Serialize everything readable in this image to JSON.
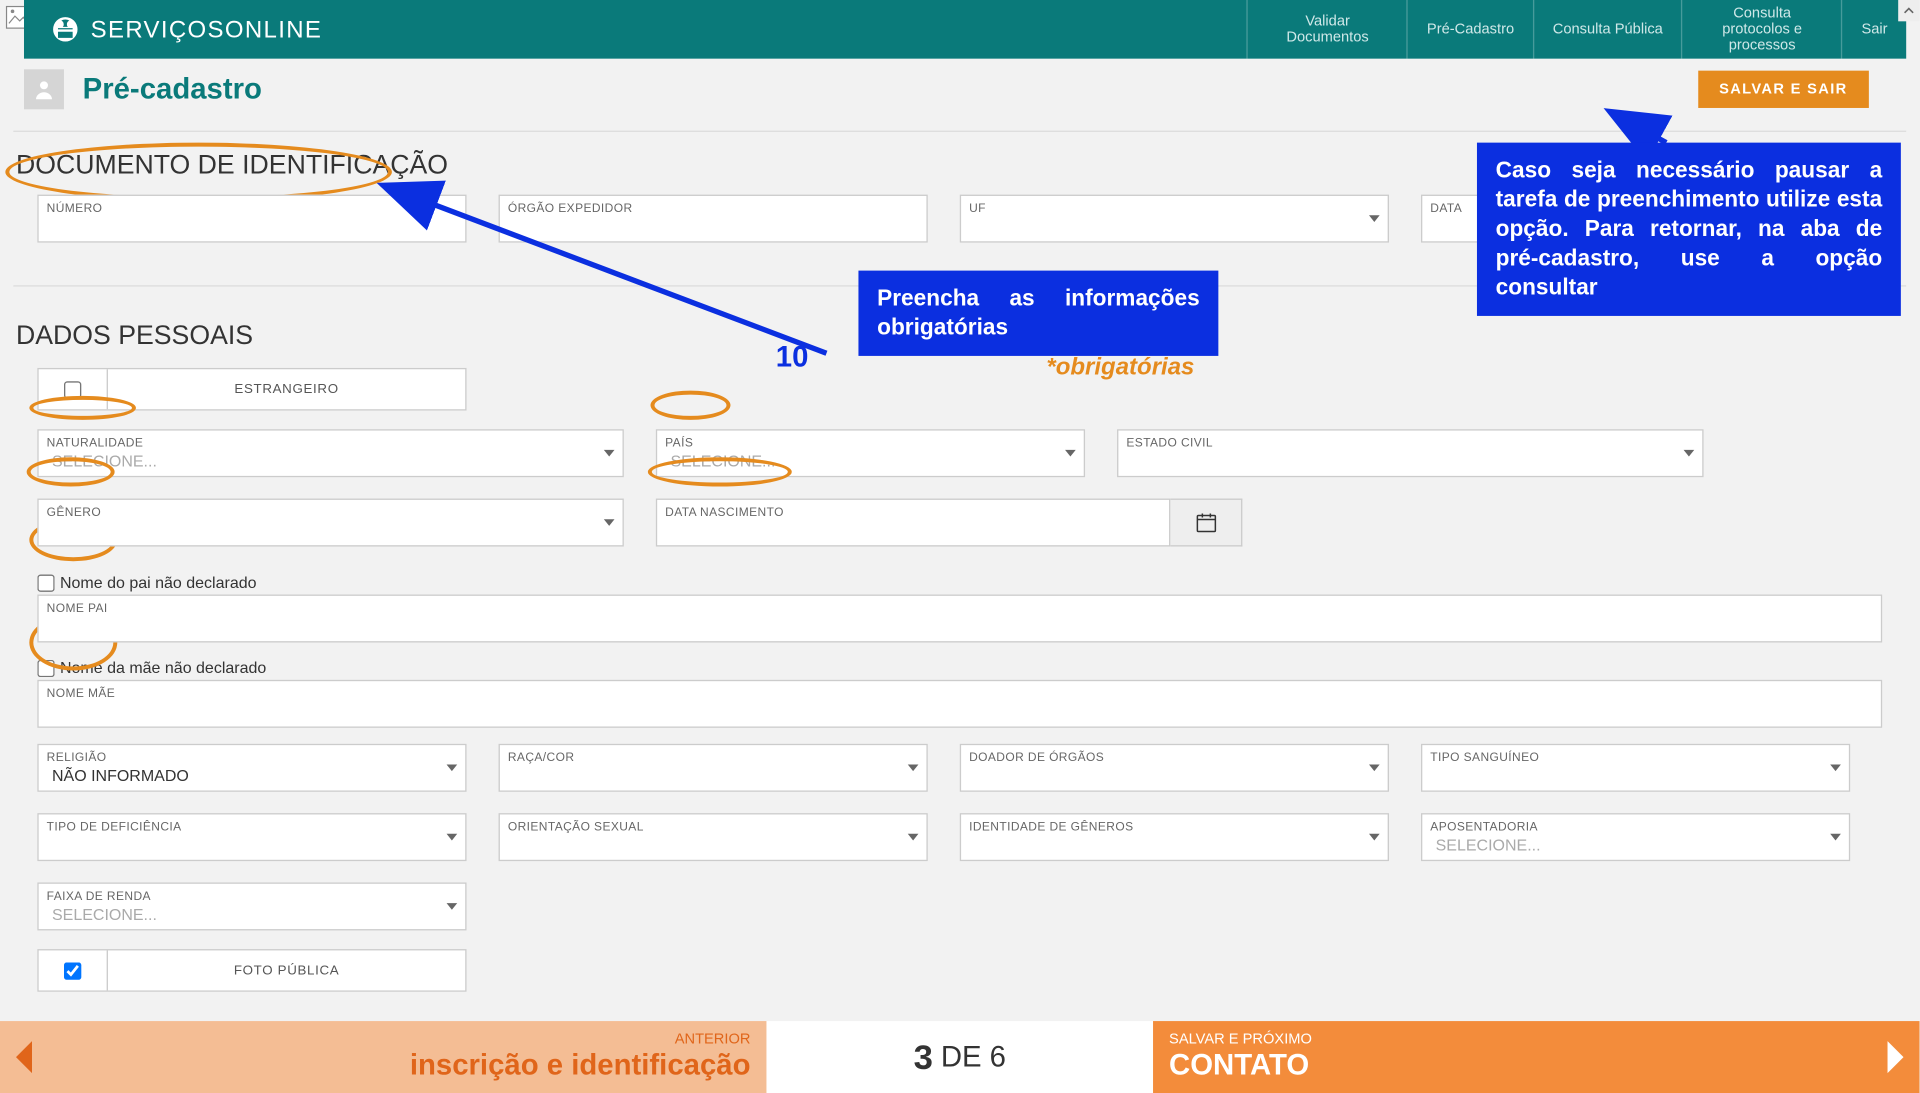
{
  "header": {
    "brand": "SERVIÇOSONLINE",
    "nav": {
      "validar": "Validar Documentos",
      "precadastro": "Pré-Cadastro",
      "consulta": "Consulta Pública",
      "protocolos": "Consulta protocolos e processos",
      "sair": "Sair"
    }
  },
  "page": {
    "title": "Pré-cadastro",
    "save_exit": "SALVAR E SAIR"
  },
  "sections": {
    "documento": {
      "title": "DOCUMENTO DE IDENTIFICAÇÃO",
      "numero": "NÚMERO",
      "orgao": "ÓRGÃO EXPEDIDOR",
      "uf": "UF",
      "data": "DATA"
    },
    "dados": {
      "title": "DADOS PESSOAIS",
      "estrangeiro_label": "ESTRANGEIRO",
      "naturalidade": {
        "label": "NATURALIDADE",
        "placeholder": "SELECIONE..."
      },
      "pais": {
        "label": "PAÍS",
        "placeholder": "SELECIONE..."
      },
      "estado_civil": "ESTADO CIVIL",
      "genero": "GÊNERO",
      "data_nasc": "DATA NASCIMENTO",
      "nome_pai_chk": "Nome do pai não declarado",
      "nome_pai": "NOME PAI",
      "nome_mae_chk": "Nome da mãe não declarado",
      "nome_mae": "NOME MÃE",
      "religiao": {
        "label": "RELIGIÃO",
        "value": "NÃO INFORMADO"
      },
      "raca": "RAÇA/COR",
      "doador": "DOADOR DE ÓRGÃOS",
      "sangue": "TIPO SANGUÍNEO",
      "deficiencia": "TIPO DE DEFICIÊNCIA",
      "orientacao": "ORIENTAÇÃO SEXUAL",
      "identidade": "IDENTIDADE DE GÊNEROS",
      "aposentadoria": {
        "label": "APOSENTADORIA",
        "placeholder": "SELECIONE..."
      },
      "faixa_renda": {
        "label": "FAIXA DE RENDA",
        "placeholder": "SELECIONE..."
      },
      "foto_publica": "FOTO PÚBLICA"
    }
  },
  "annotations": {
    "number": "10",
    "preencha": "Preencha as informações obrigatórias",
    "obrigatorias": "*obrigatórias",
    "salvar_hint": "Caso seja necessário pausar a tarefa de preenchimento utilize esta opção. Para retornar, na aba de pré-cadastro, use a opção consultar"
  },
  "footer": {
    "prev_small": "ANTERIOR",
    "prev_big": "inscrição e identificação",
    "step_cur": "3",
    "step_word": "DE",
    "step_total": "6",
    "next_small": "SALVAR E PRÓXIMO",
    "next_big": "CONTATO"
  }
}
